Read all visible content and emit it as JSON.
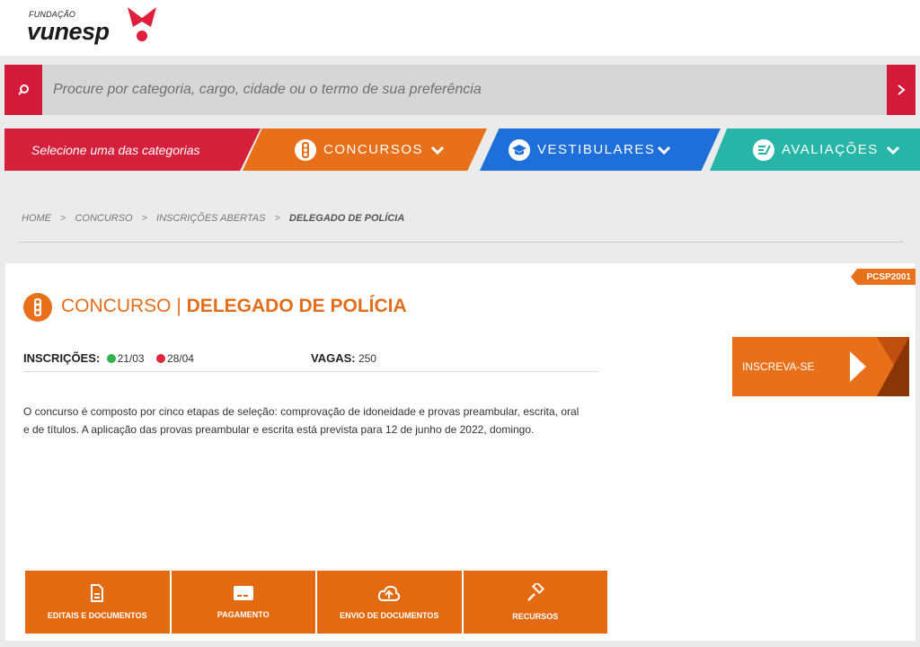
{
  "logo": {
    "small": "FUNDAÇÃO",
    "main": "vunesp"
  },
  "search": {
    "placeholder": "Procure por categoria, cargo, cidade ou o termo de sua preferência"
  },
  "categories": {
    "select_label": "Selecione uma das categorias",
    "items": [
      {
        "label": "CONCURSOS",
        "icon": "traffic-light-icon",
        "color": "#e8701a"
      },
      {
        "label": "VESTIBULARES",
        "icon": "graduation-cap-icon",
        "color": "#1e6fd9"
      },
      {
        "label": "AVALIAÇÕES",
        "icon": "evaluation-icon",
        "color": "#27b5a8"
      }
    ]
  },
  "breadcrumb": [
    "HOME",
    "CONCURSO",
    "INSCRIÇÕES ABERTAS",
    "DELEGADO DE POLÍCIA"
  ],
  "breadcrumb_sep": ">",
  "card": {
    "code": "PCSP2001",
    "title_prefix": "CONCURSO |",
    "title_main": "DELEGADO DE POLÍCIA",
    "inscricoes_label": "INSCRIÇÕES:",
    "start_date": "21/03",
    "end_date": "28/04",
    "vagas_label": "VAGAS:",
    "vagas_value": "250",
    "description": "O concurso é composto por cinco etapas de seleção: comprovação de idoneidade e provas preambular, escrita, oral e de títulos. A aplicação das provas preambular e escrita está prevista para 12 de junho de 2022, domingo.",
    "cta_label": "INSCREVA-SE",
    "actions": [
      {
        "label": "EDITAIS E DOCUMENTOS",
        "icon": "document-icon"
      },
      {
        "label": "PAGAMENTO",
        "icon": "payment-card-icon"
      },
      {
        "label": "ENVIO DE DOCUMENTOS",
        "icon": "cloud-upload-icon"
      },
      {
        "label": "RECURSOS",
        "icon": "gavel-icon"
      }
    ]
  },
  "colors": {
    "red": "#d41a3a",
    "orange": "#e8701a",
    "green": "#2fb34a",
    "dot_red": "#e0263d"
  }
}
